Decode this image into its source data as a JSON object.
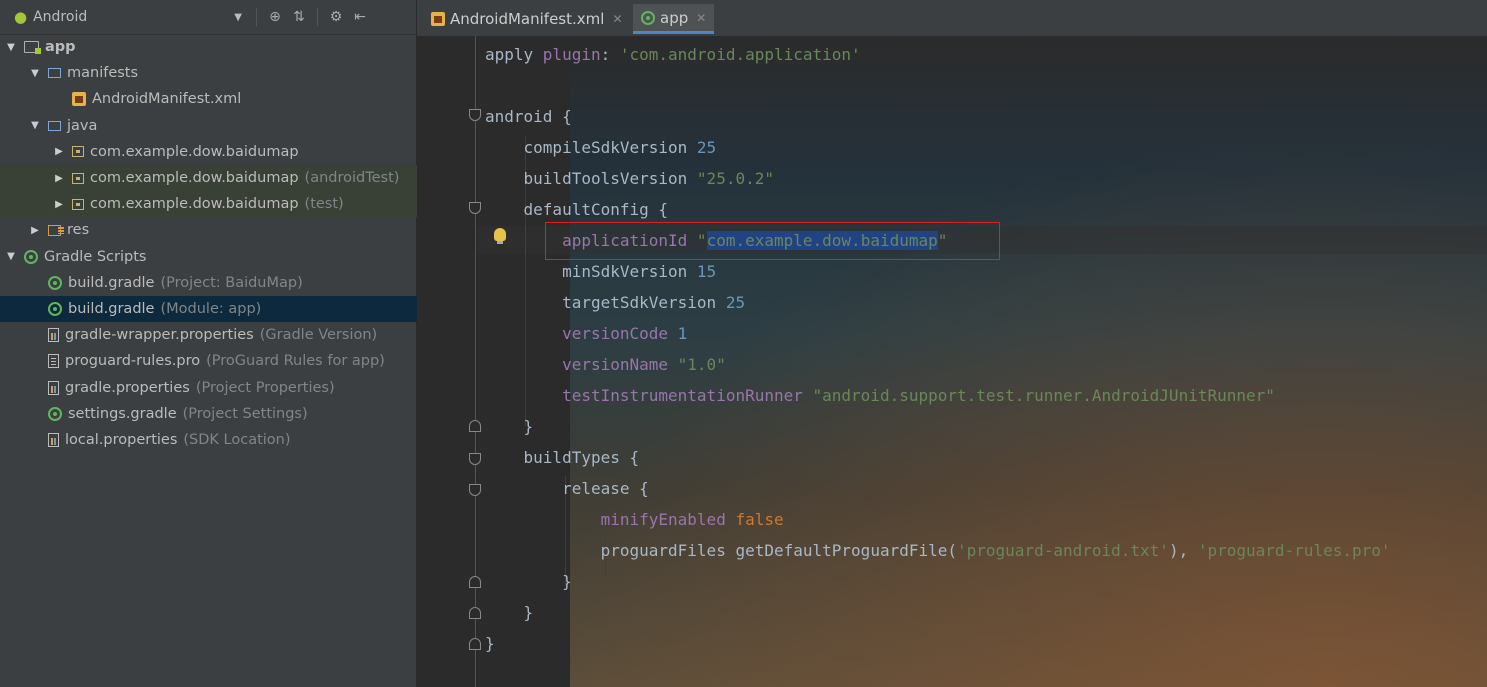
{
  "project_panel": {
    "view_mode": "Android",
    "tree": [
      {
        "label": "app",
        "hint": "",
        "indent": 0,
        "arrow": "▼",
        "icon": "app-module-icon",
        "bold": true
      },
      {
        "label": "manifests",
        "hint": "",
        "indent": 1,
        "arrow": "▼",
        "icon": "folder-icon"
      },
      {
        "label": "AndroidManifest.xml",
        "hint": "",
        "indent": 2,
        "arrow": "",
        "icon": "xml-file-icon"
      },
      {
        "label": "java",
        "hint": "",
        "indent": 1,
        "arrow": "▼",
        "icon": "folder-icon"
      },
      {
        "label": "com.example.dow.baidumap",
        "hint": "",
        "indent": 2,
        "arrow": "▶",
        "icon": "package-icon"
      },
      {
        "label": "com.example.dow.baidumap",
        "hint": "(androidTest)",
        "indent": 2,
        "arrow": "▶",
        "icon": "package-icon",
        "green": true
      },
      {
        "label": "com.example.dow.baidumap",
        "hint": "(test)",
        "indent": 2,
        "arrow": "▶",
        "icon": "package-icon",
        "green": true
      },
      {
        "label": "res",
        "hint": "",
        "indent": 1,
        "arrow": "▶",
        "icon": "res-folder-icon"
      },
      {
        "label": "Gradle Scripts",
        "hint": "",
        "indent": 0,
        "arrow": "▼",
        "icon": "gradle-icon"
      },
      {
        "label": "build.gradle",
        "hint": "(Project: BaiduMap)",
        "indent": 1,
        "arrow": "",
        "icon": "gradle-icon"
      },
      {
        "label": "build.gradle",
        "hint": "(Module: app)",
        "indent": 1,
        "arrow": "",
        "icon": "gradle-icon",
        "selected": true
      },
      {
        "label": "gradle-wrapper.properties",
        "hint": "(Gradle Version)",
        "indent": 1,
        "arrow": "",
        "icon": "properties-file-icon"
      },
      {
        "label": "proguard-rules.pro",
        "hint": "(ProGuard Rules for app)",
        "indent": 1,
        "arrow": "",
        "icon": "text-file-icon"
      },
      {
        "label": "gradle.properties",
        "hint": "(Project Properties)",
        "indent": 1,
        "arrow": "",
        "icon": "properties-file-icon"
      },
      {
        "label": "settings.gradle",
        "hint": "(Project Settings)",
        "indent": 1,
        "arrow": "",
        "icon": "gradle-icon"
      },
      {
        "label": "local.properties",
        "hint": "(SDK Location)",
        "indent": 1,
        "arrow": "",
        "icon": "properties-file-icon"
      }
    ]
  },
  "tabs": [
    {
      "label": "AndroidManifest.xml",
      "icon": "xml-file-icon",
      "active": false
    },
    {
      "label": "app",
      "icon": "gradle-icon",
      "active": true
    }
  ],
  "code_lines": [
    [
      [
        "plain",
        "apply "
      ],
      [
        "pn",
        "plugin"
      ],
      [
        "plain",
        ": "
      ],
      [
        "str",
        "'com.android.application'"
      ]
    ],
    [],
    [
      [
        "plain",
        "android {"
      ]
    ],
    [
      [
        "plain",
        "    compileSdkVersion "
      ],
      [
        "num",
        "25"
      ]
    ],
    [
      [
        "plain",
        "    buildToolsVersion "
      ],
      [
        "str",
        "\"25.0.2\""
      ]
    ],
    [
      [
        "plain",
        "    defaultConfig {"
      ]
    ],
    [
      [
        "plain",
        "        "
      ],
      [
        "pn",
        "applicationId "
      ],
      [
        "str",
        "\""
      ],
      [
        "selstr",
        "com.example.dow.baidumap"
      ],
      [
        "str",
        "\""
      ]
    ],
    [
      [
        "plain",
        "        minSdkVersion "
      ],
      [
        "num",
        "15"
      ]
    ],
    [
      [
        "plain",
        "        targetSdkVersion "
      ],
      [
        "num",
        "25"
      ]
    ],
    [
      [
        "plain",
        "        "
      ],
      [
        "pn",
        "versionCode "
      ],
      [
        "num",
        "1"
      ]
    ],
    [
      [
        "plain",
        "        "
      ],
      [
        "pn",
        "versionName "
      ],
      [
        "str",
        "\"1.0\""
      ]
    ],
    [
      [
        "plain",
        "        "
      ],
      [
        "pn",
        "testInstrumentationRunner "
      ],
      [
        "str",
        "\"android.support.test.runner.AndroidJUnitRunner\""
      ]
    ],
    [
      [
        "plain",
        "    }"
      ]
    ],
    [
      [
        "plain",
        "    buildTypes {"
      ]
    ],
    [
      [
        "plain",
        "        release {"
      ]
    ],
    [
      [
        "plain",
        "            "
      ],
      [
        "pn",
        "minifyEnabled "
      ],
      [
        "kw",
        "false"
      ]
    ],
    [
      [
        "plain",
        "            proguardFiles getDefaultProguardFile("
      ],
      [
        "str",
        "'proguard-android.txt'"
      ],
      [
        "plain",
        "), "
      ],
      [
        "str",
        "'proguard-rules.pro'"
      ]
    ],
    [
      [
        "plain",
        "        }"
      ]
    ],
    [
      [
        "plain",
        "    }"
      ]
    ],
    [
      [
        "plain",
        "}"
      ]
    ]
  ]
}
